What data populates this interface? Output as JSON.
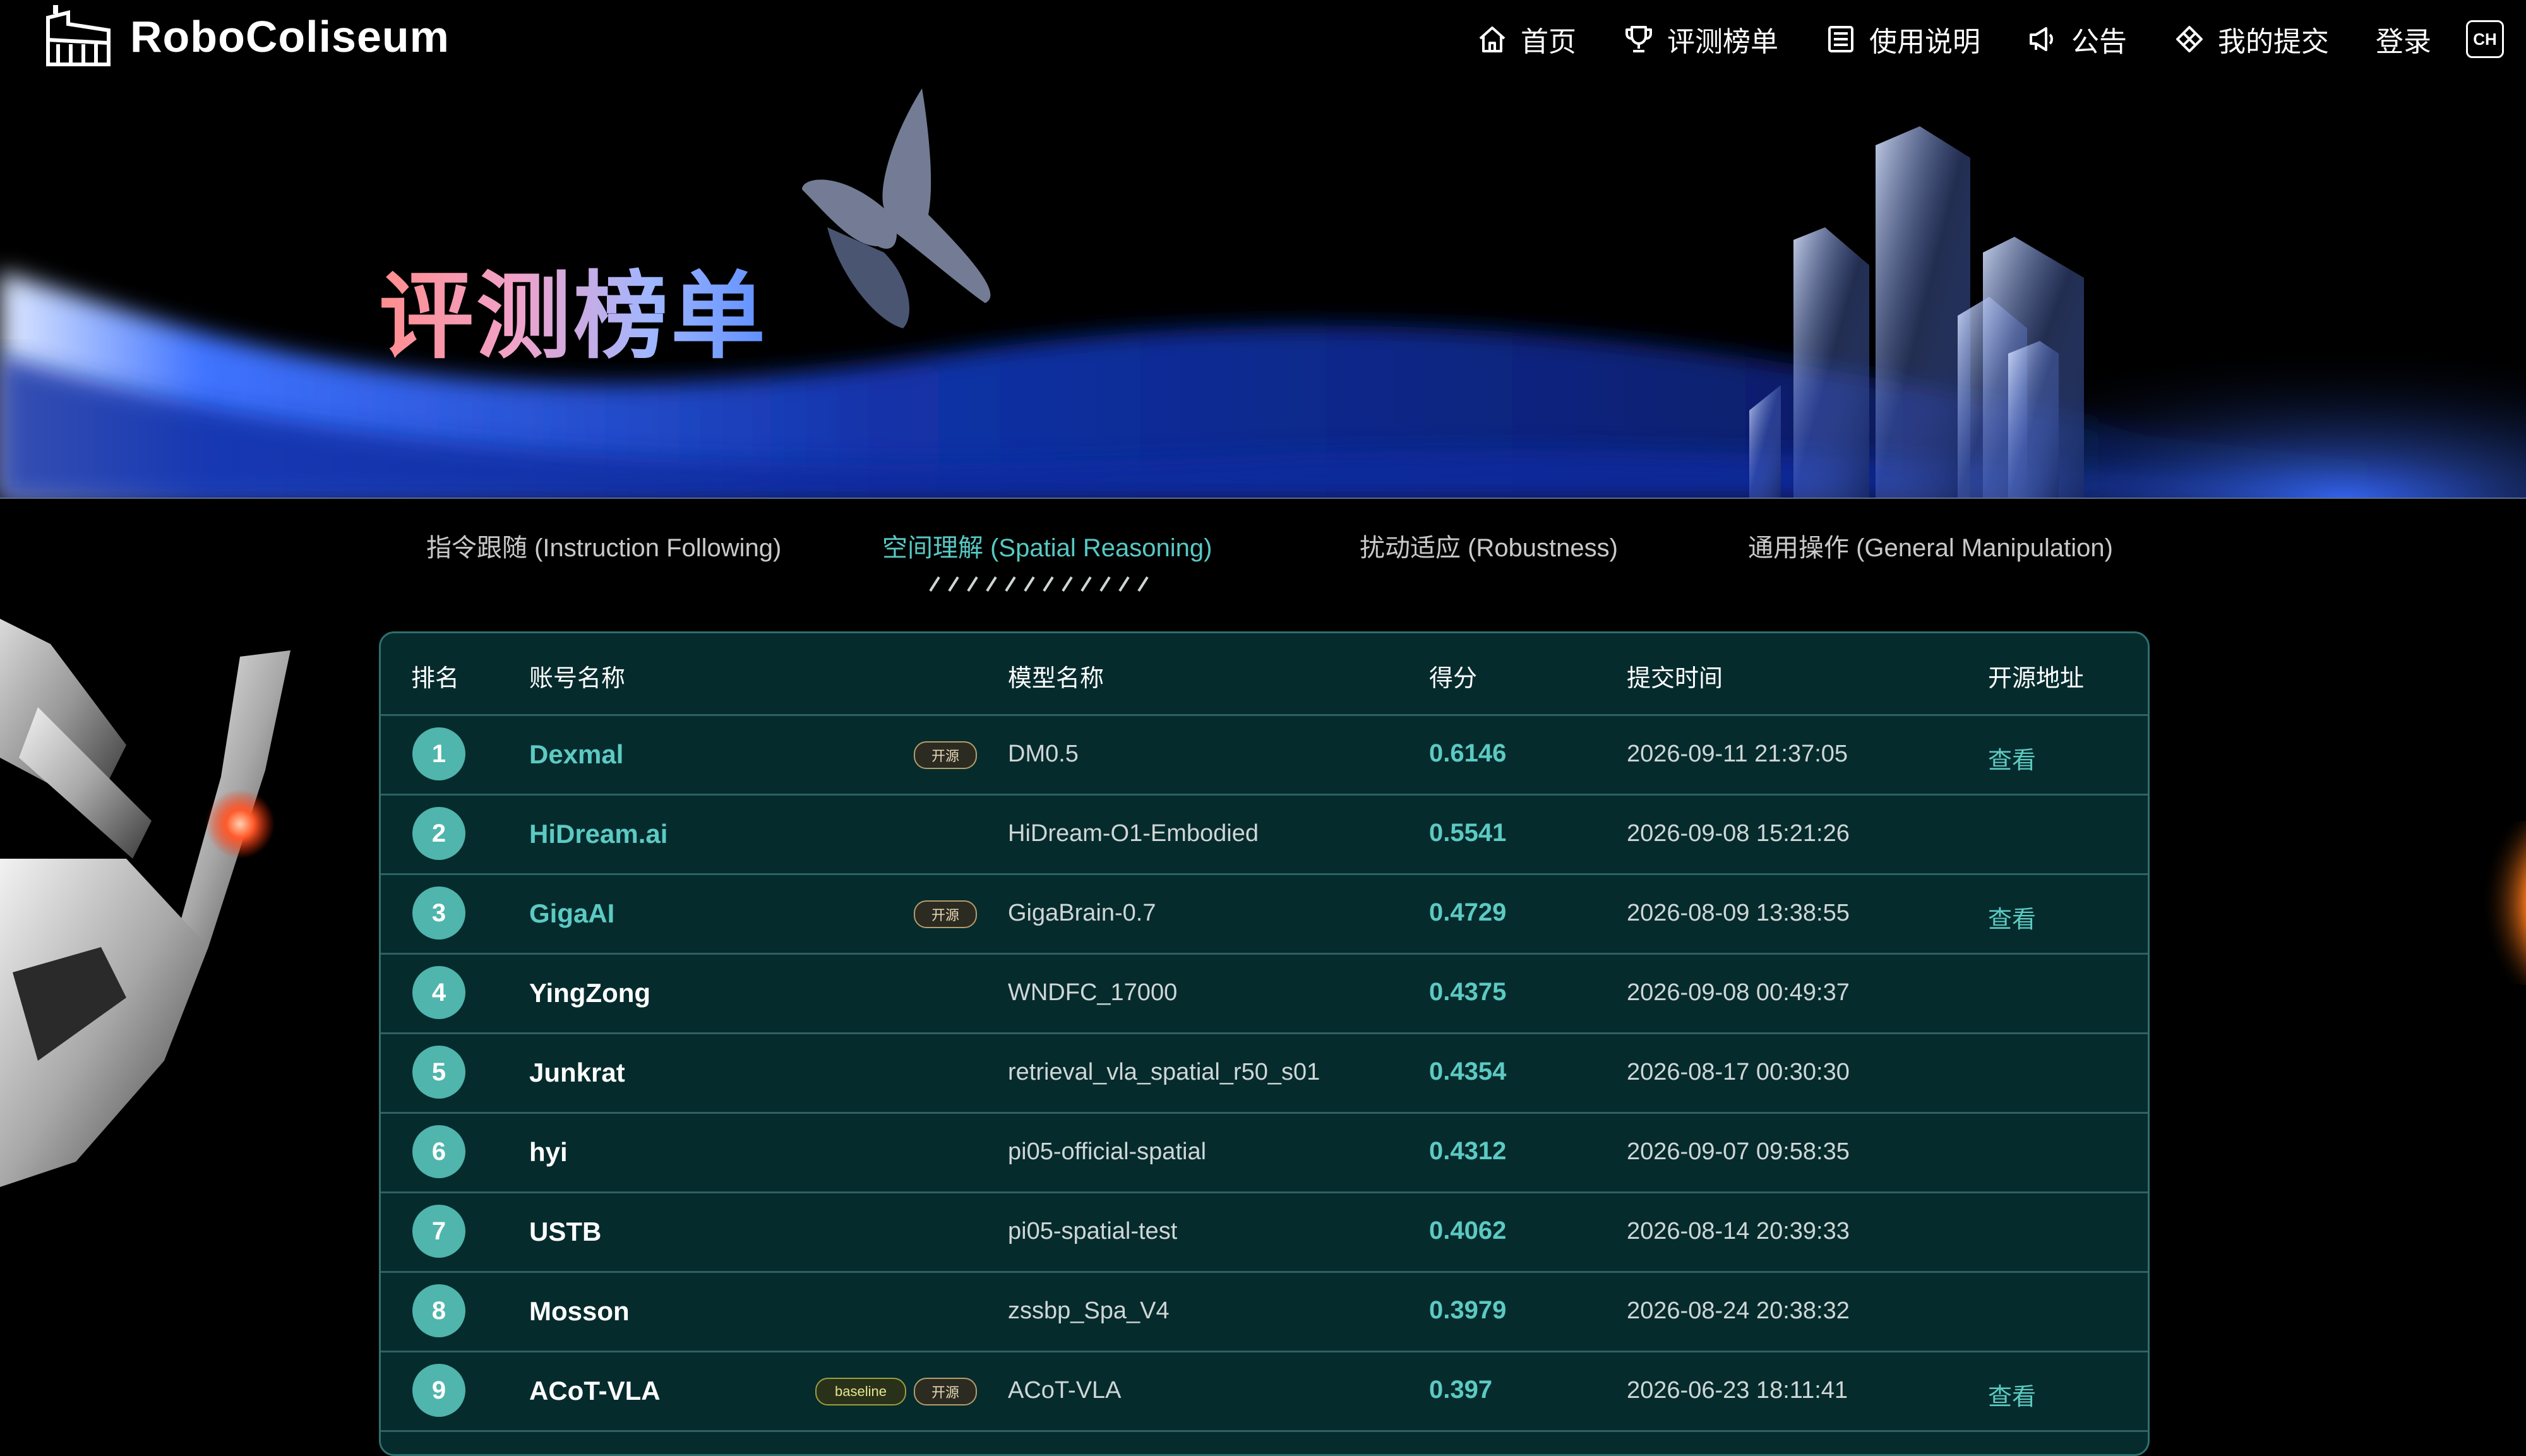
{
  "nav": {
    "logo_text": "RoboColiseum",
    "items": [
      {
        "label": "首页",
        "icon": "home-icon"
      },
      {
        "label": "评测榜单",
        "icon": "trophy-icon"
      },
      {
        "label": "使用说明",
        "icon": "document-icon"
      },
      {
        "label": "公告",
        "icon": "megaphone-icon"
      },
      {
        "label": "我的提交",
        "icon": "submission-icon"
      },
      {
        "label": "登录"
      }
    ],
    "lang": "CH"
  },
  "hero": {
    "title": "评测榜单"
  },
  "tabs": [
    {
      "label": "指令跟随 (Instruction Following)",
      "active": false
    },
    {
      "label": "空间理解 (Spatial Reasoning)",
      "active": true
    },
    {
      "label": "扰动适应 (Robustness)",
      "active": false
    },
    {
      "label": "通用操作 (General Manipulation)",
      "active": false
    }
  ],
  "table": {
    "headers": [
      "排名",
      "账号名称",
      "模型名称",
      "得分",
      "提交时间",
      "开源地址"
    ],
    "rows": [
      {
        "rank": "1",
        "account": "Dexmal",
        "badges": [
          "开源"
        ],
        "model": "DM0.5",
        "score": "0.6146",
        "time": "2026-09-11 21:37:05",
        "link": "查看",
        "highlight": true
      },
      {
        "rank": "2",
        "account": "HiDream.ai",
        "badges": [],
        "model": "HiDream-O1-Embodied",
        "score": "0.5541",
        "time": "2026-09-08 15:21:26",
        "link": "",
        "highlight": true
      },
      {
        "rank": "3",
        "account": "GigaAI",
        "badges": [
          "开源"
        ],
        "model": "GigaBrain-0.7",
        "score": "0.4729",
        "time": "2026-08-09 13:38:55",
        "link": "查看",
        "highlight": true
      },
      {
        "rank": "4",
        "account": "YingZong",
        "badges": [],
        "model": "WNDFC_17000",
        "score": "0.4375",
        "time": "2026-09-08 00:49:37",
        "link": "",
        "highlight": false
      },
      {
        "rank": "5",
        "account": "Junkrat",
        "badges": [],
        "model": "retrieval_vla_spatial_r50_s01",
        "score": "0.4354",
        "time": "2026-08-17 00:30:30",
        "link": "",
        "highlight": false
      },
      {
        "rank": "6",
        "account": "hyi",
        "badges": [],
        "model": "pi05-official-spatial",
        "score": "0.4312",
        "time": "2026-09-07 09:58:35",
        "link": "",
        "highlight": false
      },
      {
        "rank": "7",
        "account": "USTB",
        "badges": [],
        "model": "pi05-spatial-test",
        "score": "0.4062",
        "time": "2026-08-14 20:39:33",
        "link": "",
        "highlight": false
      },
      {
        "rank": "8",
        "account": "Mosson",
        "badges": [],
        "model": "zssbp_Spa_V4",
        "score": "0.3979",
        "time": "2026-08-24 20:38:32",
        "link": "",
        "highlight": false
      },
      {
        "rank": "9",
        "account": "ACoT-VLA",
        "badges": [
          "baseline",
          "开源"
        ],
        "model": "ACoT-VLA",
        "score": "0.397",
        "time": "2026-06-23 18:11:41",
        "link": "查看",
        "highlight": false
      }
    ]
  },
  "colors": {
    "accent": "#57c9c4",
    "table_bg": "#062b2d",
    "rank_circle": "#4fb5ad"
  }
}
